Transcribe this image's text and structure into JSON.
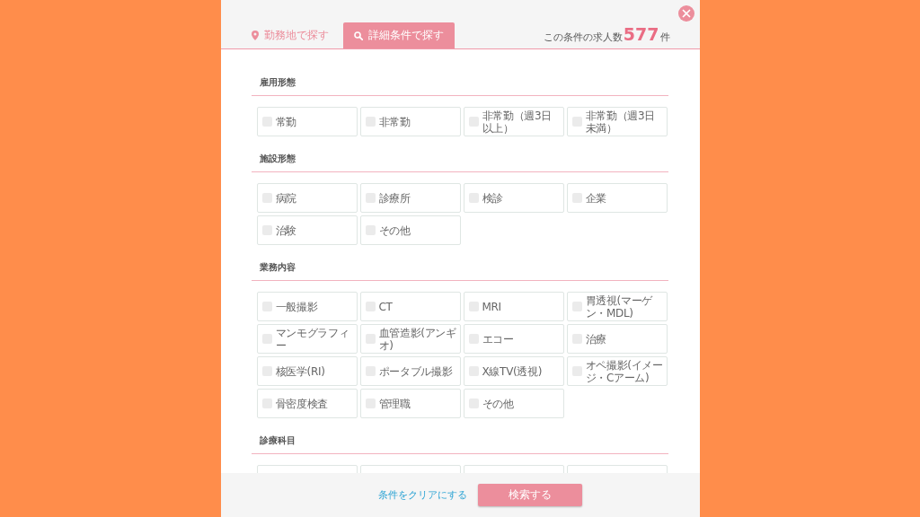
{
  "tabs": [
    {
      "label": "勤務地で探す",
      "selected": false
    },
    {
      "label": "詳細条件で探す",
      "selected": true
    }
  ],
  "result_count": {
    "prefix": "この条件の求人数",
    "number": "577",
    "suffix": "件"
  },
  "sections": [
    {
      "title": "雇用形態",
      "items": [
        {
          "label": "常勤",
          "checked": false
        },
        {
          "label": "非常勤",
          "checked": false
        },
        {
          "label": "非常勤（週3日以上）",
          "checked": false
        },
        {
          "label": "非常勤（週3日未満）",
          "checked": false
        }
      ]
    },
    {
      "title": "施設形態",
      "items": [
        {
          "label": "病院",
          "checked": false
        },
        {
          "label": "診療所",
          "checked": false
        },
        {
          "label": "検診",
          "checked": false
        },
        {
          "label": "企業",
          "checked": false
        },
        {
          "label": "治験",
          "checked": false
        },
        {
          "label": "その他",
          "checked": false
        }
      ]
    },
    {
      "title": "業務内容",
      "items": [
        {
          "label": "一般撮影",
          "checked": false
        },
        {
          "label": "CT",
          "checked": false
        },
        {
          "label": "MRI",
          "checked": false
        },
        {
          "label": "胃透視(マーゲン・MDL)",
          "checked": false
        },
        {
          "label": "マンモグラフィー",
          "checked": false
        },
        {
          "label": "血管造影(アンギオ)",
          "checked": false
        },
        {
          "label": "エコー",
          "checked": false
        },
        {
          "label": "治療",
          "checked": false
        },
        {
          "label": "核医学(RI)",
          "checked": false
        },
        {
          "label": "ポータブル撮影",
          "checked": false
        },
        {
          "label": "X線TV(透視)",
          "checked": false
        },
        {
          "label": "オペ撮影(イメージ・Cアーム)",
          "checked": false
        },
        {
          "label": "骨密度検査",
          "checked": false
        },
        {
          "label": "管理職",
          "checked": false
        },
        {
          "label": "その他",
          "checked": false
        }
      ]
    },
    {
      "title": "診療科目",
      "items": [
        {
          "kind": "cut_off"
        },
        {
          "kind": "cut_off"
        },
        {
          "kind": "cut_off"
        },
        {
          "kind": "cut_off"
        }
      ]
    }
  ],
  "footer": {
    "clear_link": "条件をクリアにする",
    "search_button": "検索する"
  }
}
